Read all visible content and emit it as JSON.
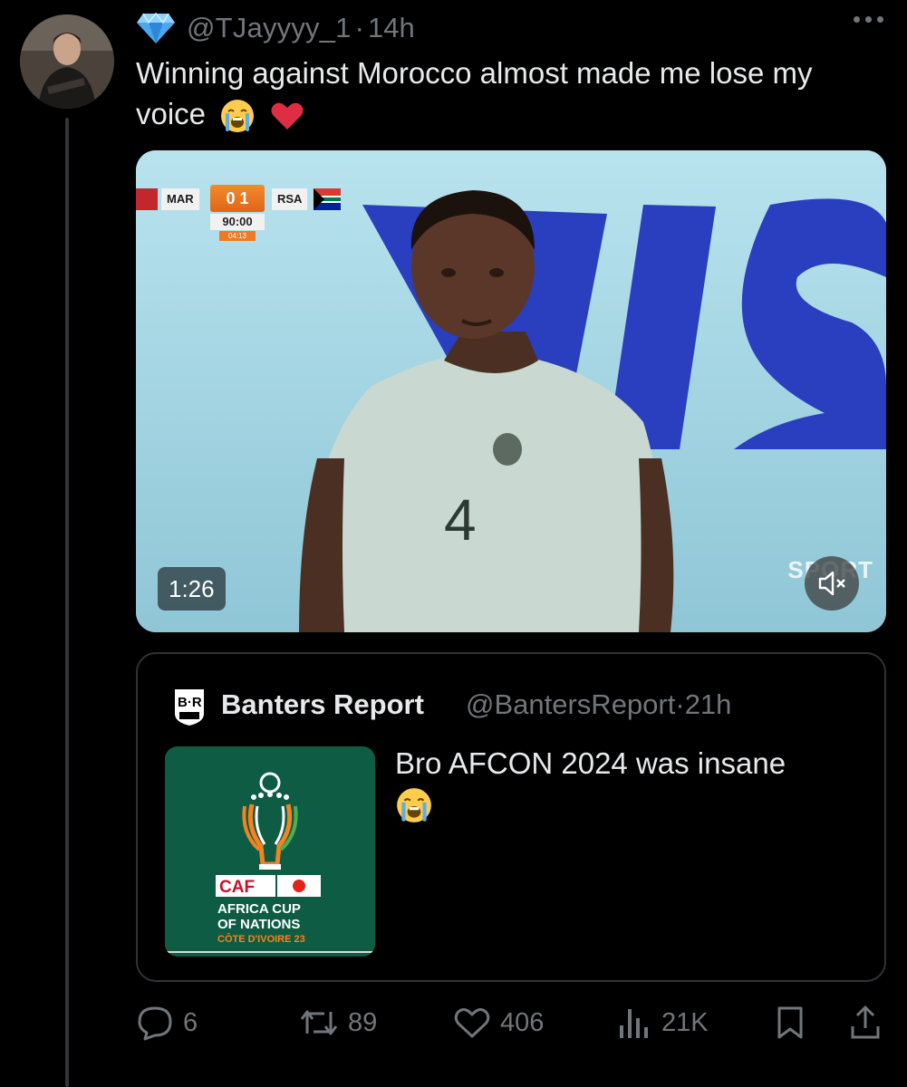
{
  "tweet": {
    "handle": "@TJayyyy_1",
    "separator": "·",
    "time": "14h",
    "text": "Winning against Morocco almost made me lose my voice",
    "verified_badge_icon": "diamond-icon"
  },
  "video": {
    "duration": "1:26",
    "scorebug": {
      "home_team": "MAR",
      "away_team": "RSA",
      "score": "0 1",
      "clock": "90:00",
      "added_time": "04:13"
    },
    "player_number": "4",
    "watermark": "SPORT"
  },
  "quote": {
    "name": "Banters Report",
    "handle": "@BantersReport",
    "separator": "·",
    "time": "21h",
    "text": "Bro AFCON 2024 was insane",
    "image": {
      "brand": "CAF",
      "line1": "AFRICA CUP",
      "line2": "OF NATIONS",
      "line3": "CÔTE D'IVOIRE 23"
    }
  },
  "actions": {
    "replies": "6",
    "reposts": "89",
    "likes": "406",
    "views": "21K"
  },
  "colors": {
    "background": "#000000",
    "text": "#e7e9ea",
    "muted": "#71767b",
    "border": "#2f3336"
  }
}
